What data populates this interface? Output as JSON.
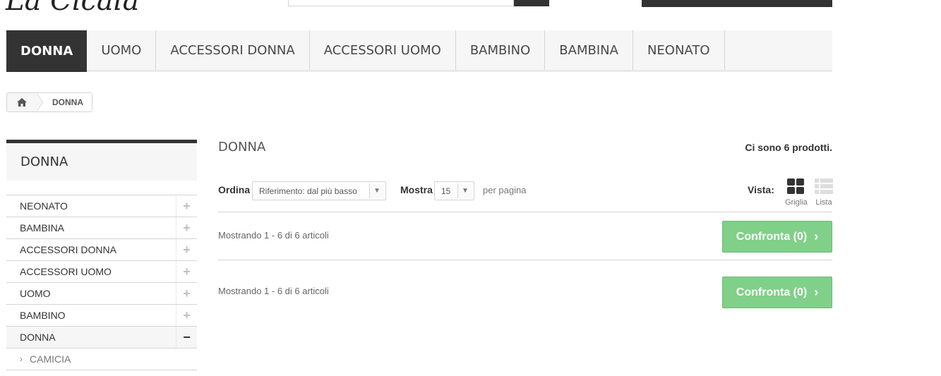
{
  "header": {
    "logo": "La Cicala",
    "search_placeholder": ""
  },
  "menu": {
    "items": [
      {
        "label": "DONNA",
        "active": true
      },
      {
        "label": "UOMO"
      },
      {
        "label": "ACCESSORI DONNA"
      },
      {
        "label": "ACCESSORI UOMO"
      },
      {
        "label": "BAMBINO"
      },
      {
        "label": "BAMBINA"
      },
      {
        "label": "NEONATO"
      }
    ]
  },
  "breadcrumb": {
    "home_icon": "home-icon",
    "current": "DONNA"
  },
  "sidebar": {
    "title": "DONNA",
    "items": [
      {
        "label": "NEONATO",
        "toggle": "+"
      },
      {
        "label": "BAMBINA",
        "toggle": "+"
      },
      {
        "label": "ACCESSORI DONNA",
        "toggle": "+"
      },
      {
        "label": "ACCESSORI UOMO",
        "toggle": "+"
      },
      {
        "label": "UOMO",
        "toggle": "+"
      },
      {
        "label": "BAMBINO",
        "toggle": "+"
      },
      {
        "label": "DONNA",
        "toggle": "−"
      }
    ],
    "subitems": [
      {
        "label": "CAMICIA"
      }
    ]
  },
  "main": {
    "title": "DONNA",
    "count": "Ci sono 6 prodotti.",
    "sort_label": "Ordina",
    "sort_value": "Riferimento: dal più basso",
    "show_label": "Mostra",
    "show_value": "15",
    "per_page": "per pagina",
    "view_label": "Vista:",
    "view_grid": "Griglia",
    "view_list": "Lista",
    "showing_top": "Mostrando 1 - 6 di 6 articoli",
    "showing_bottom": "Mostrando 1 - 6 di 6 articoli",
    "compare_label": "Confronta (0)"
  },
  "colors": {
    "accent_dark": "#333333",
    "compare_green": "#80d089"
  }
}
